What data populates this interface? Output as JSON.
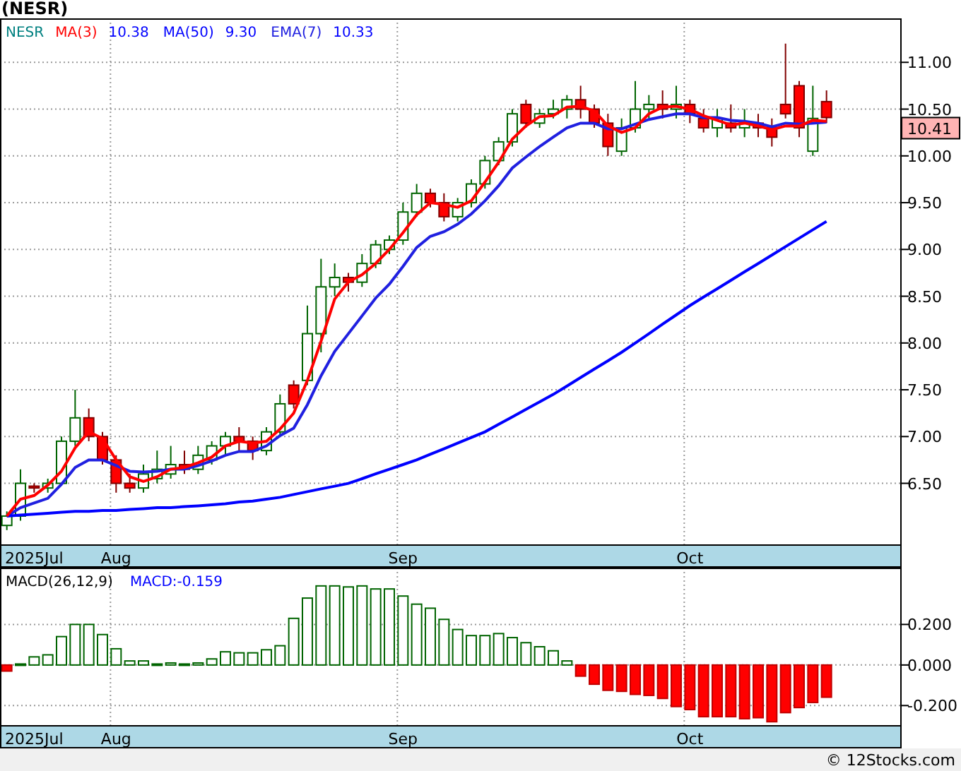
{
  "title": "(NESR)",
  "price_chart": {
    "symbol": "NESR",
    "legend_values": [
      "10.38",
      "9.30",
      "10.33"
    ],
    "last_price": "10.41",
    "chart_data": {
      "type": "candlestick",
      "grid": true,
      "ylim": [
        5.84,
        11.47
      ],
      "categories": [
        null,
        null,
        "2025Jul",
        null,
        null,
        null,
        null,
        null,
        "Aug",
        null,
        null,
        null,
        null,
        null,
        null,
        null,
        null,
        null,
        null,
        null,
        null,
        null,
        null,
        null,
        null,
        null,
        null,
        null,
        null,
        "Sep",
        null,
        null,
        null,
        null,
        null,
        null,
        null,
        null,
        null,
        null,
        null,
        null,
        null,
        null,
        null,
        null,
        null,
        null,
        null,
        null,
        "Oct",
        null,
        null,
        null,
        null,
        null,
        null,
        null,
        null,
        null,
        null,
        null,
        null,
        null,
        null,
        null
      ],
      "yticks": [
        {
          "value": 6.5,
          "label": "6.50"
        },
        {
          "value": 7,
          "label": "7.00"
        },
        {
          "value": 7.5,
          "label": "7.50"
        },
        {
          "value": 8,
          "label": "8.00"
        },
        {
          "value": 8.5,
          "label": "8.50"
        },
        {
          "value": 9,
          "label": "9.00"
        },
        {
          "value": 9.5,
          "label": "9.50"
        },
        {
          "value": 10,
          "label": "10.00"
        },
        {
          "value": 10.5,
          "label": "10.50"
        },
        {
          "value": 11,
          "label": "11.00"
        }
      ],
      "ohlc": [
        [
          6.05,
          6.2,
          6.0,
          6.15
        ],
        [
          6.15,
          6.65,
          6.1,
          6.5
        ],
        [
          6.47,
          6.5,
          6.4,
          6.45
        ],
        [
          6.45,
          6.55,
          6.4,
          6.5
        ],
        [
          6.5,
          7.0,
          6.5,
          6.95
        ],
        [
          6.95,
          7.5,
          6.9,
          7.2
        ],
        [
          7.2,
          7.3,
          6.95,
          7.0
        ],
        [
          7.0,
          7.05,
          6.7,
          6.75
        ],
        [
          6.75,
          6.8,
          6.4,
          6.5
        ],
        [
          6.5,
          6.6,
          6.4,
          6.45
        ],
        [
          6.45,
          6.7,
          6.4,
          6.6
        ],
        [
          6.55,
          6.85,
          6.5,
          6.65
        ],
        [
          6.6,
          6.9,
          6.55,
          6.7
        ],
        [
          6.7,
          6.85,
          6.6,
          6.65
        ],
        [
          6.65,
          6.9,
          6.6,
          6.8
        ],
        [
          6.75,
          6.95,
          6.7,
          6.9
        ],
        [
          6.9,
          7.05,
          6.8,
          7.0
        ],
        [
          7.0,
          7.1,
          6.85,
          6.95
        ],
        [
          6.95,
          7.0,
          6.75,
          6.85
        ],
        [
          6.85,
          7.1,
          6.8,
          7.05
        ],
        [
          7.05,
          7.45,
          7.0,
          7.35
        ],
        [
          7.55,
          7.6,
          7.3,
          7.35
        ],
        [
          7.6,
          8.4,
          7.55,
          8.1
        ],
        [
          8.1,
          8.9,
          7.9,
          8.6
        ],
        [
          8.6,
          8.85,
          8.5,
          8.7
        ],
        [
          8.7,
          8.75,
          8.55,
          8.65
        ],
        [
          8.65,
          8.95,
          8.6,
          8.85
        ],
        [
          8.85,
          9.1,
          8.8,
          9.05
        ],
        [
          9.0,
          9.15,
          8.95,
          9.1
        ],
        [
          9.1,
          9.5,
          9.05,
          9.4
        ],
        [
          9.4,
          9.7,
          9.35,
          9.6
        ],
        [
          9.6,
          9.65,
          9.45,
          9.5
        ],
        [
          9.5,
          9.6,
          9.3,
          9.35
        ],
        [
          9.35,
          9.55,
          9.3,
          9.5
        ],
        [
          9.5,
          9.75,
          9.45,
          9.7
        ],
        [
          9.7,
          10.0,
          9.65,
          9.95
        ],
        [
          9.95,
          10.2,
          9.9,
          10.15
        ],
        [
          10.15,
          10.5,
          10.1,
          10.45
        ],
        [
          10.55,
          10.6,
          10.3,
          10.35
        ],
        [
          10.35,
          10.5,
          10.3,
          10.45
        ],
        [
          10.45,
          10.6,
          10.4,
          10.5
        ],
        [
          10.5,
          10.65,
          10.4,
          10.6
        ],
        [
          10.6,
          10.75,
          10.4,
          10.5
        ],
        [
          10.5,
          10.55,
          10.3,
          10.35
        ],
        [
          10.35,
          10.45,
          10.0,
          10.1
        ],
        [
          10.05,
          10.4,
          10.0,
          10.3
        ],
        [
          10.3,
          10.8,
          10.25,
          10.5
        ],
        [
          10.5,
          10.65,
          10.4,
          10.55
        ],
        [
          10.55,
          10.7,
          10.4,
          10.5
        ],
        [
          10.5,
          10.75,
          10.4,
          10.55
        ],
        [
          10.55,
          10.6,
          10.35,
          10.45
        ],
        [
          10.4,
          10.5,
          10.25,
          10.3
        ],
        [
          10.3,
          10.5,
          10.2,
          10.4
        ],
        [
          10.35,
          10.55,
          10.25,
          10.3
        ],
        [
          10.3,
          10.5,
          10.2,
          10.35
        ],
        [
          10.35,
          10.45,
          10.2,
          10.3
        ],
        [
          10.3,
          10.4,
          10.1,
          10.2
        ],
        [
          10.55,
          11.2,
          10.4,
          10.45
        ],
        [
          10.75,
          10.8,
          10.2,
          10.3
        ],
        [
          10.05,
          10.75,
          10.0,
          10.4
        ],
        [
          10.58,
          10.7,
          10.35,
          10.41
        ],
        null,
        null,
        null,
        null,
        null
      ],
      "series": [
        {
          "name": "MA(3)",
          "type": "line",
          "color": "#ff0000",
          "values": [
            6.15,
            6.33,
            6.37,
            6.48,
            6.63,
            6.88,
            7.05,
            6.98,
            6.75,
            6.57,
            6.52,
            6.57,
            6.65,
            6.67,
            6.72,
            6.78,
            6.9,
            6.95,
            6.93,
            6.95,
            7.08,
            7.25,
            7.6,
            8.02,
            8.47,
            8.65,
            8.73,
            8.85,
            9.0,
            9.18,
            9.37,
            9.5,
            9.48,
            9.45,
            9.52,
            9.72,
            9.93,
            10.18,
            10.32,
            10.42,
            10.43,
            10.52,
            10.53,
            10.48,
            10.32,
            10.25,
            10.3,
            10.45,
            10.52,
            10.53,
            10.5,
            10.43,
            10.38,
            10.33,
            10.35,
            10.32,
            10.28,
            10.32,
            10.32,
            10.38,
            10.37,
            null,
            null,
            null,
            null,
            null
          ]
        },
        {
          "name": "MA(50)",
          "type": "line",
          "color": "#0000ff",
          "values": [
            6.15,
            6.16,
            6.17,
            6.18,
            6.19,
            6.2,
            6.2,
            6.21,
            6.21,
            6.22,
            6.23,
            6.24,
            6.24,
            6.25,
            6.26,
            6.27,
            6.28,
            6.3,
            6.31,
            6.33,
            6.35,
            6.38,
            6.41,
            6.44,
            6.47,
            6.5,
            6.55,
            6.6,
            6.65,
            6.7,
            6.75,
            6.81,
            6.87,
            6.93,
            6.99,
            7.05,
            7.13,
            7.21,
            7.29,
            7.37,
            7.45,
            7.54,
            7.63,
            7.72,
            7.81,
            7.9,
            8.0,
            8.1,
            8.2,
            8.3,
            8.4,
            8.49,
            8.58,
            8.67,
            8.76,
            8.85,
            8.94,
            9.03,
            9.12,
            9.21,
            9.3,
            null,
            null,
            null,
            null,
            null
          ]
        },
        {
          "name": "EMA(7)",
          "type": "line",
          "color": "#2020e0",
          "values": [
            6.15,
            6.24,
            6.29,
            6.34,
            6.49,
            6.67,
            6.75,
            6.75,
            6.69,
            6.63,
            6.62,
            6.63,
            6.65,
            6.65,
            6.69,
            6.74,
            6.8,
            6.84,
            6.84,
            6.9,
            7.01,
            7.09,
            7.34,
            7.65,
            7.91,
            8.1,
            8.29,
            8.48,
            8.63,
            8.82,
            9.02,
            9.14,
            9.19,
            9.27,
            9.38,
            9.52,
            9.68,
            9.87,
            9.99,
            10.1,
            10.2,
            10.3,
            10.35,
            10.35,
            10.29,
            10.29,
            10.34,
            10.39,
            10.42,
            10.45,
            10.45,
            10.41,
            10.41,
            10.38,
            10.37,
            10.35,
            10.31,
            10.35,
            10.34,
            10.35,
            10.36,
            null,
            null,
            null,
            null,
            null
          ]
        }
      ]
    }
  },
  "macd_chart": {
    "legend": [
      {
        "label": "MACD(26,12,9)",
        "kind": "study"
      },
      {
        "label": "MACD:-0.159",
        "kind": "value"
      }
    ],
    "chart_data": {
      "type": "bar",
      "grid": true,
      "ylim": [
        -0.3,
        0.48
      ],
      "categories": [
        null,
        null,
        "2025Jul",
        null,
        null,
        null,
        null,
        null,
        "Aug",
        null,
        null,
        null,
        null,
        null,
        null,
        null,
        null,
        null,
        null,
        null,
        null,
        null,
        null,
        null,
        null,
        null,
        null,
        null,
        null,
        "Sep",
        null,
        null,
        null,
        null,
        null,
        null,
        null,
        null,
        null,
        null,
        null,
        null,
        null,
        null,
        null,
        null,
        null,
        null,
        null,
        null,
        "Oct",
        null,
        null,
        null,
        null,
        null,
        null,
        null,
        null,
        null,
        null,
        null,
        null,
        null,
        null,
        null
      ],
      "yticks": [
        {
          "value": 0.2,
          "label": "0.200"
        },
        {
          "value": 0,
          "label": "0.000"
        },
        {
          "value": -0.2,
          "label": "-0.200"
        }
      ],
      "values": [
        -0.03,
        0.005,
        0.04,
        0.05,
        0.14,
        0.2,
        0.2,
        0.15,
        0.08,
        0.02,
        0.02,
        0.005,
        0.01,
        0.005,
        0.01,
        0.03,
        0.065,
        0.06,
        0.06,
        0.075,
        0.095,
        0.23,
        0.33,
        0.39,
        0.39,
        0.385,
        0.39,
        0.375,
        0.375,
        0.34,
        0.3,
        0.28,
        0.225,
        0.175,
        0.145,
        0.145,
        0.155,
        0.135,
        0.11,
        0.09,
        0.07,
        0.02,
        -0.055,
        -0.095,
        -0.125,
        -0.13,
        -0.145,
        -0.15,
        -0.165,
        -0.205,
        -0.22,
        -0.255,
        -0.255,
        -0.255,
        -0.265,
        -0.26,
        -0.28,
        -0.235,
        -0.21,
        -0.185,
        -0.159,
        null,
        null,
        null,
        null,
        null
      ]
    }
  },
  "footer": "© 12Stocks.com"
}
